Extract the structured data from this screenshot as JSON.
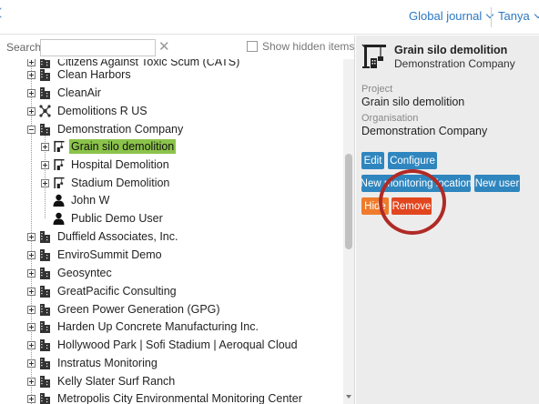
{
  "header": {
    "journal_label": "Global journal",
    "user_label": "Tanya"
  },
  "search": {
    "label": "Search",
    "value": "",
    "placeholder": "",
    "show_hidden_label": "Show hidden items",
    "show_hidden_checked": false
  },
  "tree": {
    "items": [
      {
        "label": "Citizens Against Toxic Scum (CATS)",
        "icon": "building-icon",
        "expander": "plus"
      },
      {
        "label": "Clean Harbors",
        "icon": "building-icon",
        "expander": "plus"
      },
      {
        "label": "CleanAir",
        "icon": "building-icon",
        "expander": "plus"
      },
      {
        "label": "Demolitions R US",
        "icon": "network-icon",
        "expander": "plus"
      },
      {
        "label": "Demonstration Company",
        "icon": "building-icon",
        "expander": "minus"
      },
      {
        "label": "Grain silo demolition",
        "icon": "crane-icon",
        "expander": "plus",
        "selected": true
      },
      {
        "label": "Hospital Demolition",
        "icon": "crane-icon",
        "expander": "plus"
      },
      {
        "label": "Stadium Demolition",
        "icon": "crane-icon",
        "expander": "plus"
      },
      {
        "label": "John W",
        "icon": "person-icon",
        "expander": "none"
      },
      {
        "label": "Public Demo User",
        "icon": "person-icon",
        "expander": "none"
      },
      {
        "label": "Duffield Associates, Inc.",
        "icon": "building-icon",
        "expander": "plus"
      },
      {
        "label": "EnviroSummit Demo",
        "icon": "building-icon",
        "expander": "plus"
      },
      {
        "label": "Geosyntec",
        "icon": "building-icon",
        "expander": "plus"
      },
      {
        "label": "GreatPacific Consulting",
        "icon": "building-icon",
        "expander": "plus"
      },
      {
        "label": "Green Power Generation (GPG)",
        "icon": "building-icon",
        "expander": "plus"
      },
      {
        "label": "Harden Up Concrete Manufacturing Inc.",
        "icon": "building-icon",
        "expander": "plus"
      },
      {
        "label": "Hollywood Park | Sofi Stadium | Aeroqual Cloud",
        "icon": "building-icon",
        "expander": "plus"
      },
      {
        "label": "Instratus Monitoring",
        "icon": "building-icon",
        "expander": "plus"
      },
      {
        "label": "Kelly Slater Surf Ranch",
        "icon": "building-icon",
        "expander": "plus"
      },
      {
        "label": "Metropolis City Environmental Monitoring Center",
        "icon": "building-icon",
        "expander": "plus"
      }
    ]
  },
  "details": {
    "title": "Grain silo demolition",
    "subtitle": "Demonstration Company",
    "project_label": "Project",
    "project_value": "Grain silo demolition",
    "organisation_label": "Organisation",
    "organisation_value": "Demonstration Company",
    "buttons": {
      "edit": "Edit",
      "configure": "Configure",
      "new_location": "New monitoring location",
      "new_user": "New user",
      "hide": "Hide",
      "remove": "Remove"
    }
  },
  "colors": {
    "link": "#2a78c2",
    "selected": "#8bc34a",
    "button_blue": "#2f86bf",
    "button_orange": "#ef7c2c",
    "button_red": "#e2461f",
    "annotation": "#b02a25"
  }
}
